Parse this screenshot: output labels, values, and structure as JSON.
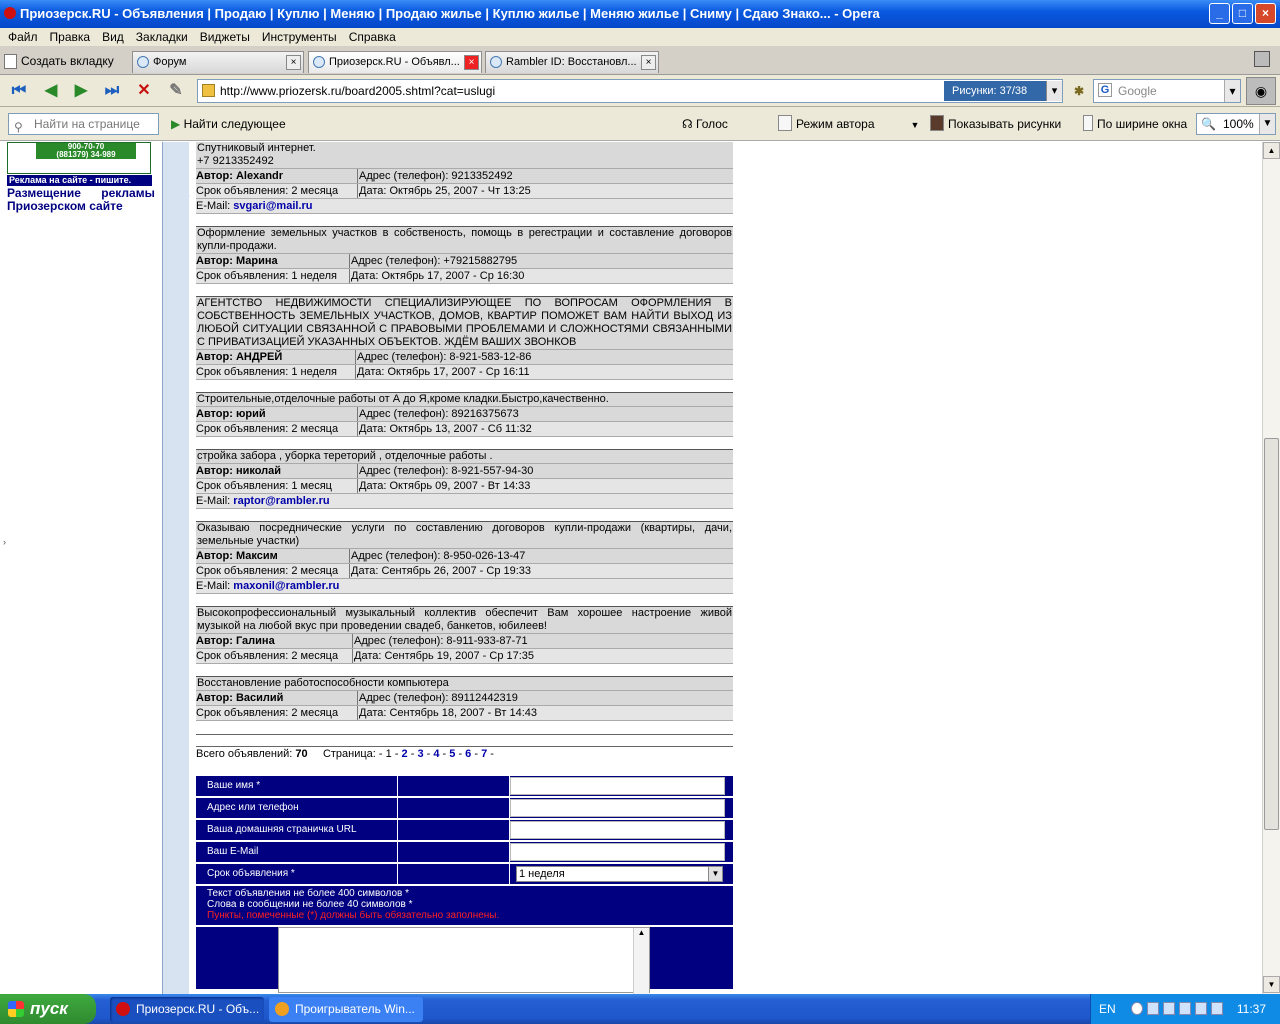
{
  "window": {
    "title": "Приозерск.RU - Объявления | Продаю | Куплю | Меняю | Продаю жилье | Куплю жилье | Меняю жилье | Сниму | Сдаю Знако... - Opera"
  },
  "menu": [
    "Файл",
    "Правка",
    "Вид",
    "Закладки",
    "Виджеты",
    "Инструменты",
    "Справка"
  ],
  "tabs": {
    "new_tab": "Создать вкладку",
    "items": [
      {
        "label": "Форум"
      },
      {
        "label": "Приозерск.RU - Объявл..."
      },
      {
        "label": "Rambler ID: Восстановл..."
      }
    ]
  },
  "address": {
    "url": "http://www.priozersk.ru/board2005.shtml?cat=uslugi",
    "images_label": "Рисунки:",
    "images_count": "37/38"
  },
  "search": {
    "placeholder": "Google"
  },
  "findbar": {
    "placeholder": "Найти на странице",
    "find_next": "Найти следующее",
    "voice": "Голос",
    "author_mode": "Режим автора",
    "show_images": "Показывать рисунки",
    "fit_width": "По ширине окна",
    "zoom": "100%"
  },
  "left": {
    "banner_phone1": "900-70-70",
    "banner_phone2": "(881379) 34-989",
    "ad_strip": "Реклама на сайте - пишите.",
    "placement_link": "Размещение рекламы на Приозерском сайте"
  },
  "ads": [
    {
      "text": "Спутниковый интернет.\n+7 9213352492",
      "author": "Автор: Alexandr",
      "address": "Адрес (телефон): 9213352492",
      "term": "Срок объявления: 2 месяца",
      "date": "Дата: Октябрь 25, 2007 - Чт 13:25",
      "email_label": "E-Mail:",
      "email": "svgari@mail.ru"
    },
    {
      "text": "Оформление земельных участков в собственость, помощь в регестрации и составление договоров купли-продажи.",
      "author": "Автор: Марина",
      "address": "Адрес (телефон): +79215882795",
      "term": "Срок объявления: 1 неделя",
      "date": "Дата: Октябрь 17, 2007 - Ср 16:30"
    },
    {
      "text": "АГЕНТСТВО НЕДВИЖИМОСТИ СПЕЦИАЛИЗИРУЮЩЕЕ ПО ВОПРОСАМ ОФОРМЛЕНИЯ В СОБСТВЕННОСТЬ ЗЕМЕЛЬНЫХ УЧАСТКОВ, ДОМОВ, КВАРТИР ПОМОЖЕТ ВАМ НАЙТИ ВЫХОД ИЗ ЛЮБОЙ СИТУАЦИИ СВЯЗАННОЙ С ПРАВОВЫМИ ПРОБЛЕМАМИ И СЛОЖНОСТЯМИ СВЯЗАННЫМИ С ПРИВАТИЗАЦИЕЙ УКАЗАННЫХ ОБЪЕКТОВ. ЖДЁМ ВАШИХ ЗВОНКОВ",
      "author": "Автор: АНДРЕЙ",
      "address": "Адрес (телефон): 8-921-583-12-86",
      "term": "Срок объявления: 1 неделя",
      "date": "Дата: Октябрь 17, 2007 - Ср 16:11"
    },
    {
      "text": "Строительные,отделочные работы от А до Я,кроме кладки.Быстро,качественно.",
      "author": "Автор: юрий",
      "address": "Адрес (телефон): 89216375673",
      "term": "Срок объявления: 2 месяца",
      "date": "Дата: Октябрь 13, 2007 - Сб 11:32"
    },
    {
      "text": "стройка забора , уборка тереторий , отделочные работы .",
      "author": "Автор: николай",
      "address": "Адрес (телефон): 8-921-557-94-30",
      "term": "Срок объявления: 1 месяц",
      "date": "Дата: Октябрь 09, 2007 - Вт 14:33",
      "email_label": "E-Mail:",
      "email": "raptor@rambler.ru"
    },
    {
      "text": "Оказываю посреднические услуги по составлению договоров купли-продажи (квартиры, дачи, земельные участки)",
      "author": "Автор: Максим",
      "address": "Адрес (телефон): 8-950-026-13-47",
      "term": "Срок объявления: 2 месяца",
      "date": "Дата: Сентябрь 26, 2007 - Ср 19:33",
      "email_label": "E-Mail:",
      "email": "maxonil@rambler.ru"
    },
    {
      "text": "Высокопрофессиональный музыкальный коллектив обеспечит Вам хорошее настроение живой музыкой на любой вкус при проведении свадеб, банкетов, юбилеев!",
      "author": "Автор: Галина",
      "address": "Адрес (телефон): 8-911-933-87-71",
      "term": "Срок объявления: 2 месяца",
      "date": "Дата: Сентябрь 19, 2007 - Ср 17:35"
    },
    {
      "text": "Восстановление работоспособности компьютера",
      "author": "Автор: Василий",
      "address": "Адрес (телефон): 89112442319",
      "term": "Срок объявления: 2 месяца",
      "date": "Дата: Сентябрь 18, 2007 - Вт 14:43"
    }
  ],
  "pagination": {
    "total_label": "Всего объявлений:",
    "total": "70",
    "page_label": "Страница:",
    "current": "1",
    "pages": [
      "2",
      "3",
      "4",
      "5",
      "6",
      "7"
    ]
  },
  "form": {
    "name_label": "Ваше имя *",
    "address_label": "Адрес или телефон",
    "url_label": "Ваша домашняя страничка URL",
    "email_label": "Ваш E-Mail",
    "term_label": "Срок объявления *",
    "term_value": "1 неделя",
    "note1": "Текст объявления не более 400 символов *",
    "note2": "Слова в сообщении не более 40 символов *",
    "note_required": "Пункты, помеченные (*) должны быть обязательно заполнены."
  },
  "taskbar": {
    "start": "пуск",
    "tasks": [
      "Приозерск.RU - Объ...",
      "Проигрыватель Win..."
    ],
    "lang": "EN",
    "clock": "11:37"
  }
}
